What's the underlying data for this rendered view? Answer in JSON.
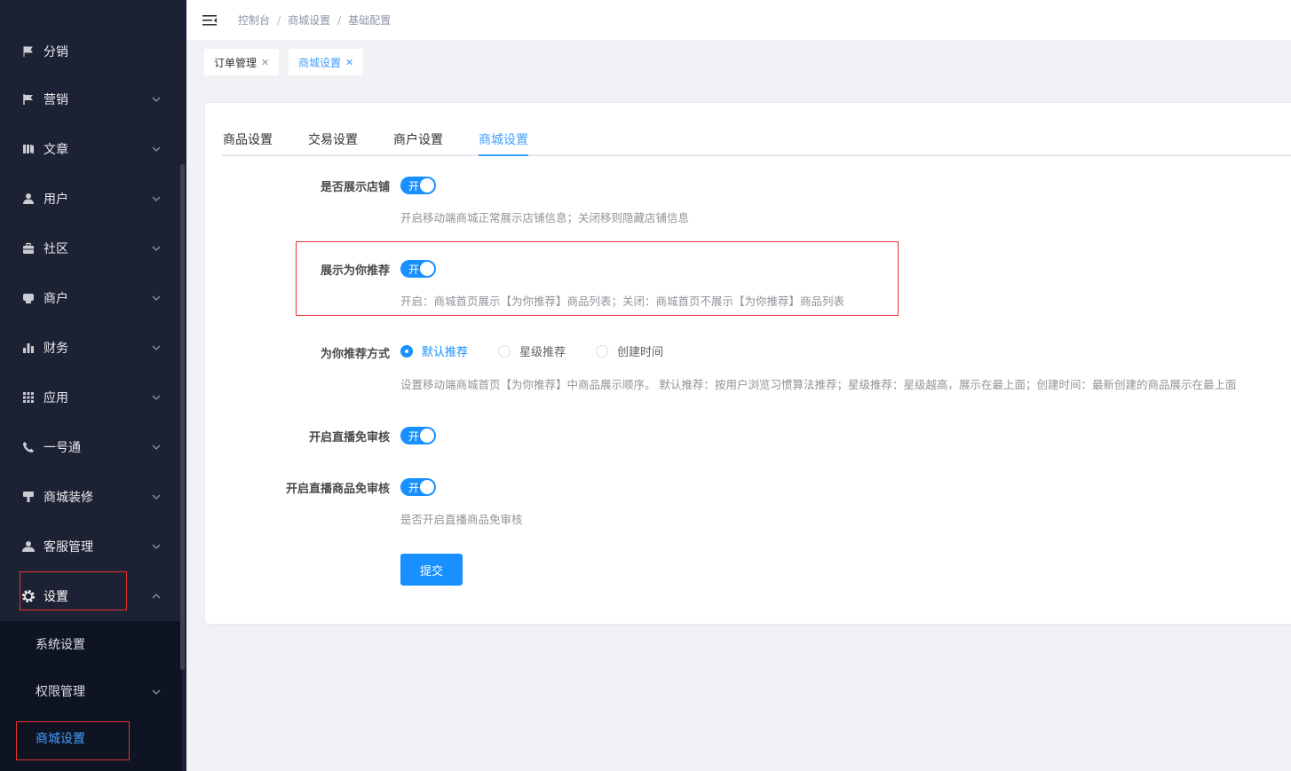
{
  "sidebar": {
    "partial_top_label": "分销",
    "items": [
      {
        "label": "营销",
        "icon": "flag-icon"
      },
      {
        "label": "文章",
        "icon": "article-icon"
      },
      {
        "label": "用户",
        "icon": "user-icon"
      },
      {
        "label": "社区",
        "icon": "community-icon"
      },
      {
        "label": "商户",
        "icon": "merchant-icon"
      },
      {
        "label": "财务",
        "icon": "chart-bar-icon"
      },
      {
        "label": "应用",
        "icon": "grid-icon"
      },
      {
        "label": "一号通",
        "icon": "phone-icon"
      },
      {
        "label": "商城装修",
        "icon": "brush-icon"
      },
      {
        "label": "客服管理",
        "icon": "support-icon"
      },
      {
        "label": "设置",
        "icon": "gear-icon"
      }
    ],
    "sub_items": [
      {
        "label": "系统设置"
      },
      {
        "label": "权限管理"
      },
      {
        "label": "商城设置"
      }
    ]
  },
  "breadcrumb": [
    "控制台",
    "商城设置",
    "基础配置"
  ],
  "tags": [
    {
      "label": "订单管理"
    },
    {
      "label": "商城设置"
    }
  ],
  "form_tabs": [
    "商品设置",
    "交易设置",
    "商户设置",
    "商城设置"
  ],
  "form": {
    "show_store": {
      "label": "是否展示店铺",
      "switch_text": "开",
      "hint": "开启移动端商城正常展示店铺信息；关闭移则隐藏店铺信息"
    },
    "show_recommend": {
      "label": "展示为你推荐",
      "switch_text": "开",
      "hint": "开启：商城首页展示【为你推荐】商品列表；关闭：商城首页不展示【为你推荐】商品列表"
    },
    "recommend_mode": {
      "label": "为你推荐方式",
      "options": [
        "默认推荐",
        "星级推荐",
        "创建时间"
      ],
      "selected": "默认推荐",
      "hint": "设置移动端商城首页【为你推荐】中商品展示顺序。 默认推荐：按用户浏览习惯算法推荐；星级推荐：星级越高，展示在最上面；创建时间：最新创建的商品展示在最上面"
    },
    "live_no_review": {
      "label": "开启直播免审核",
      "switch_text": "开"
    },
    "live_goods_no_review": {
      "label": "开启直播商品免审核",
      "switch_text": "开",
      "hint": "是否开启直播商品免审核"
    },
    "submit_label": "提交"
  },
  "colors": {
    "primary": "#1890ff",
    "sidebar_bg": "#1c2233",
    "highlight_box": "#e5322f"
  }
}
